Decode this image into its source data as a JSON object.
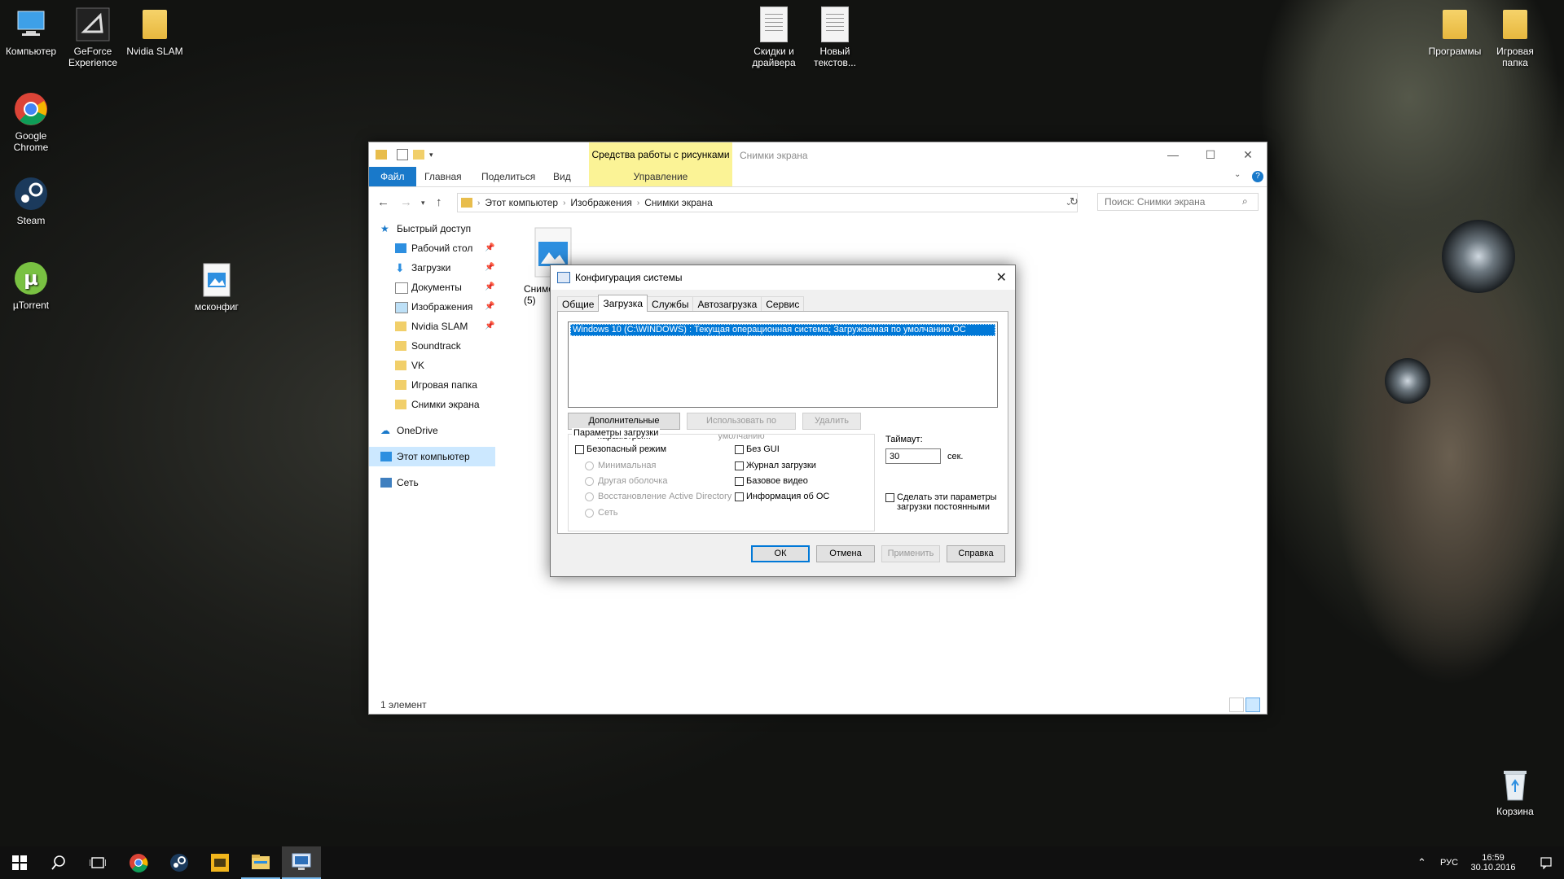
{
  "desktop": {
    "icons": [
      {
        "label": "Компьютер"
      },
      {
        "label": "GeForce Experience"
      },
      {
        "label": "Nvidia SLAM"
      },
      {
        "label": "Google Chrome"
      },
      {
        "label": "Steam"
      },
      {
        "label": "µTorrent"
      },
      {
        "label": "мсконфиг"
      },
      {
        "label": "Скидки и драйвера"
      },
      {
        "label": "Новый текстов..."
      },
      {
        "label": "Программы"
      },
      {
        "label": "Игровая папка"
      },
      {
        "label": "Корзина"
      }
    ]
  },
  "explorer": {
    "context_tab_header": "Средства работы с рисунками",
    "title": "Снимки экрана",
    "ribbon_tabs": [
      "Файл",
      "Главная",
      "Поделиться",
      "Вид",
      "Управление"
    ],
    "address": [
      "Этот компьютер",
      "Изображения",
      "Снимки экрана"
    ],
    "search_placeholder": "Поиск: Снимки экрана",
    "nav": {
      "quick_access": "Быстрый доступ",
      "items": [
        "Рабочий стол",
        "Загрузки",
        "Документы",
        "Изображения",
        "Nvidia SLAM",
        "Soundtrack",
        "VK",
        "Игровая папка",
        "Снимки экрана"
      ],
      "onedrive": "OneDrive",
      "this_pc": "Этот компьютер",
      "network": "Сеть"
    },
    "file": {
      "name": "Снимок",
      "suffix": "(5)"
    },
    "status": "1 элемент"
  },
  "dialog": {
    "title": "Конфигурация системы",
    "tabs": [
      "Общие",
      "Загрузка",
      "Службы",
      "Автозагрузка",
      "Сервис"
    ],
    "os_entry": "Windows 10 (C:\\WINDOWS) : Текущая операционная система; Загружаемая по умолчанию ОС",
    "buttons": {
      "advanced": "Дополнительные параметры...",
      "set_default": "Использовать по умолчанию",
      "delete": "Удалить",
      "ok": "ОК",
      "cancel": "Отмена",
      "apply": "Применить",
      "help": "Справка"
    },
    "boot_options": {
      "title": "Параметры загрузки",
      "safe_mode": "Безопасный режим",
      "minimal": "Минимальная",
      "alt_shell": "Другая оболочка",
      "ad_repair": "Восстановление Active Directory",
      "network": "Сеть",
      "no_gui": "Без GUI",
      "boot_log": "Журнал загрузки",
      "base_video": "Базовое видео",
      "os_info": "Информация  об ОС"
    },
    "timeout_label": "Таймаут:",
    "timeout_value": "30",
    "timeout_unit": "сек.",
    "permanent": "Сделать эти параметры загрузки постоянными"
  },
  "taskbar": {
    "lang": "РУС",
    "time": "16:59",
    "date": "30.10.2016"
  },
  "colors": {
    "accent": "#0078d7",
    "context_tab": "#fbf396"
  }
}
